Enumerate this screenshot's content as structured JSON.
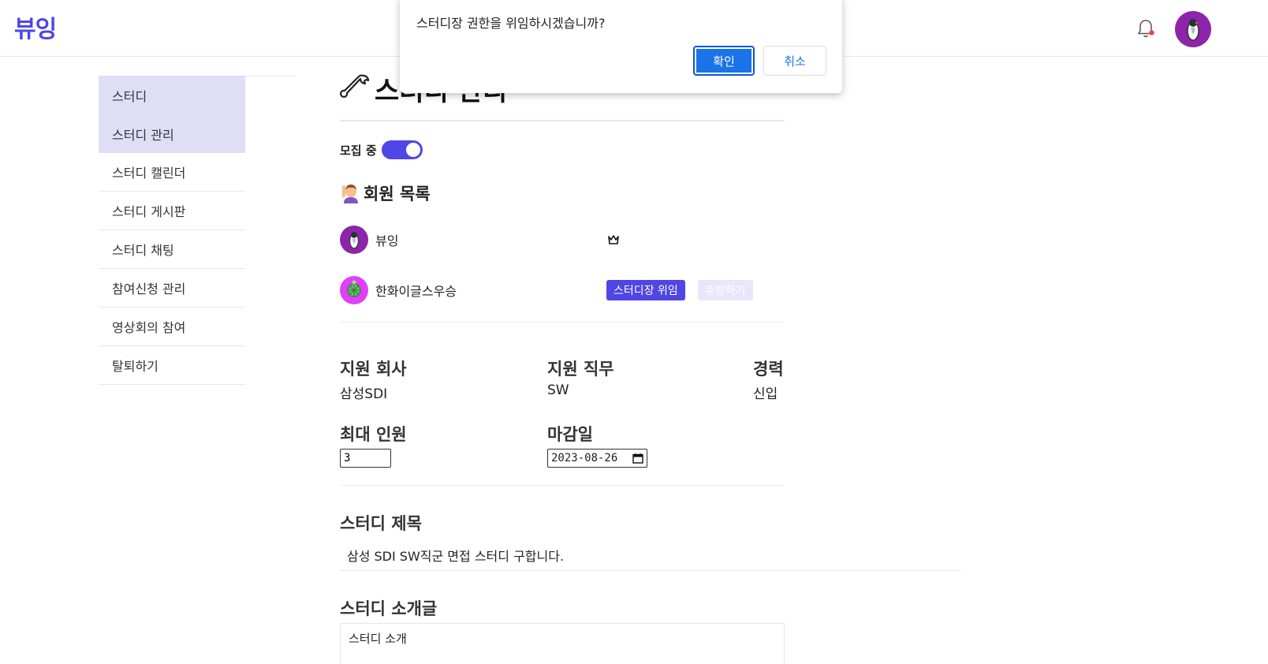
{
  "header": {
    "logo": "뷰잉",
    "notification_icon": "bell-icon",
    "avatar_icon": "penguin-avatar"
  },
  "sidebar": {
    "items": [
      {
        "label": "스터디",
        "active": true
      },
      {
        "label": "스터디 관리",
        "active": true
      },
      {
        "label": "스터디 캘린더",
        "active": false
      },
      {
        "label": "스터디 게시판",
        "active": false
      },
      {
        "label": "스터디 채팅",
        "active": false
      },
      {
        "label": "참여신청 관리",
        "active": false
      },
      {
        "label": "영상회의 참여",
        "active": false
      },
      {
        "label": "탈퇴하기",
        "active": false
      }
    ]
  },
  "main": {
    "title": "스터디 관리",
    "recruit_label": "모집 중",
    "recruit_on": true,
    "members_title": "회원 목록",
    "members": [
      {
        "name": "뷰잉",
        "role": "leader",
        "avatar_color": "#8e24aa"
      },
      {
        "name": "한화이글스우승",
        "role": "member",
        "avatar_color": "#e040fb",
        "delegate_label": "스터디장 위임",
        "kick_label": "추방하기"
      }
    ],
    "company_label": "지원 회사",
    "company_value": "삼성SDI",
    "job_label": "지원 직무",
    "job_value": "SW",
    "career_label": "경력",
    "career_value": "신입",
    "max_label": "최대 인원",
    "max_value": "3",
    "deadline_label": "마감일",
    "deadline_value": "2023-08-26",
    "study_title_label": "스터디 제목",
    "study_title_value": "삼성 SDI SW직군 면접 스터디 구합니다.",
    "intro_label": "스터디 소개글",
    "intro_value": "스터디 소개"
  },
  "dialog": {
    "message": "스터디장 권한을 위임하시겠습니까?",
    "ok_label": "확인",
    "cancel_label": "취소"
  },
  "colors": {
    "accent": "#4f46e5",
    "sidebar_active": "#e0ddf7",
    "dialog_button": "#1a73e8"
  }
}
